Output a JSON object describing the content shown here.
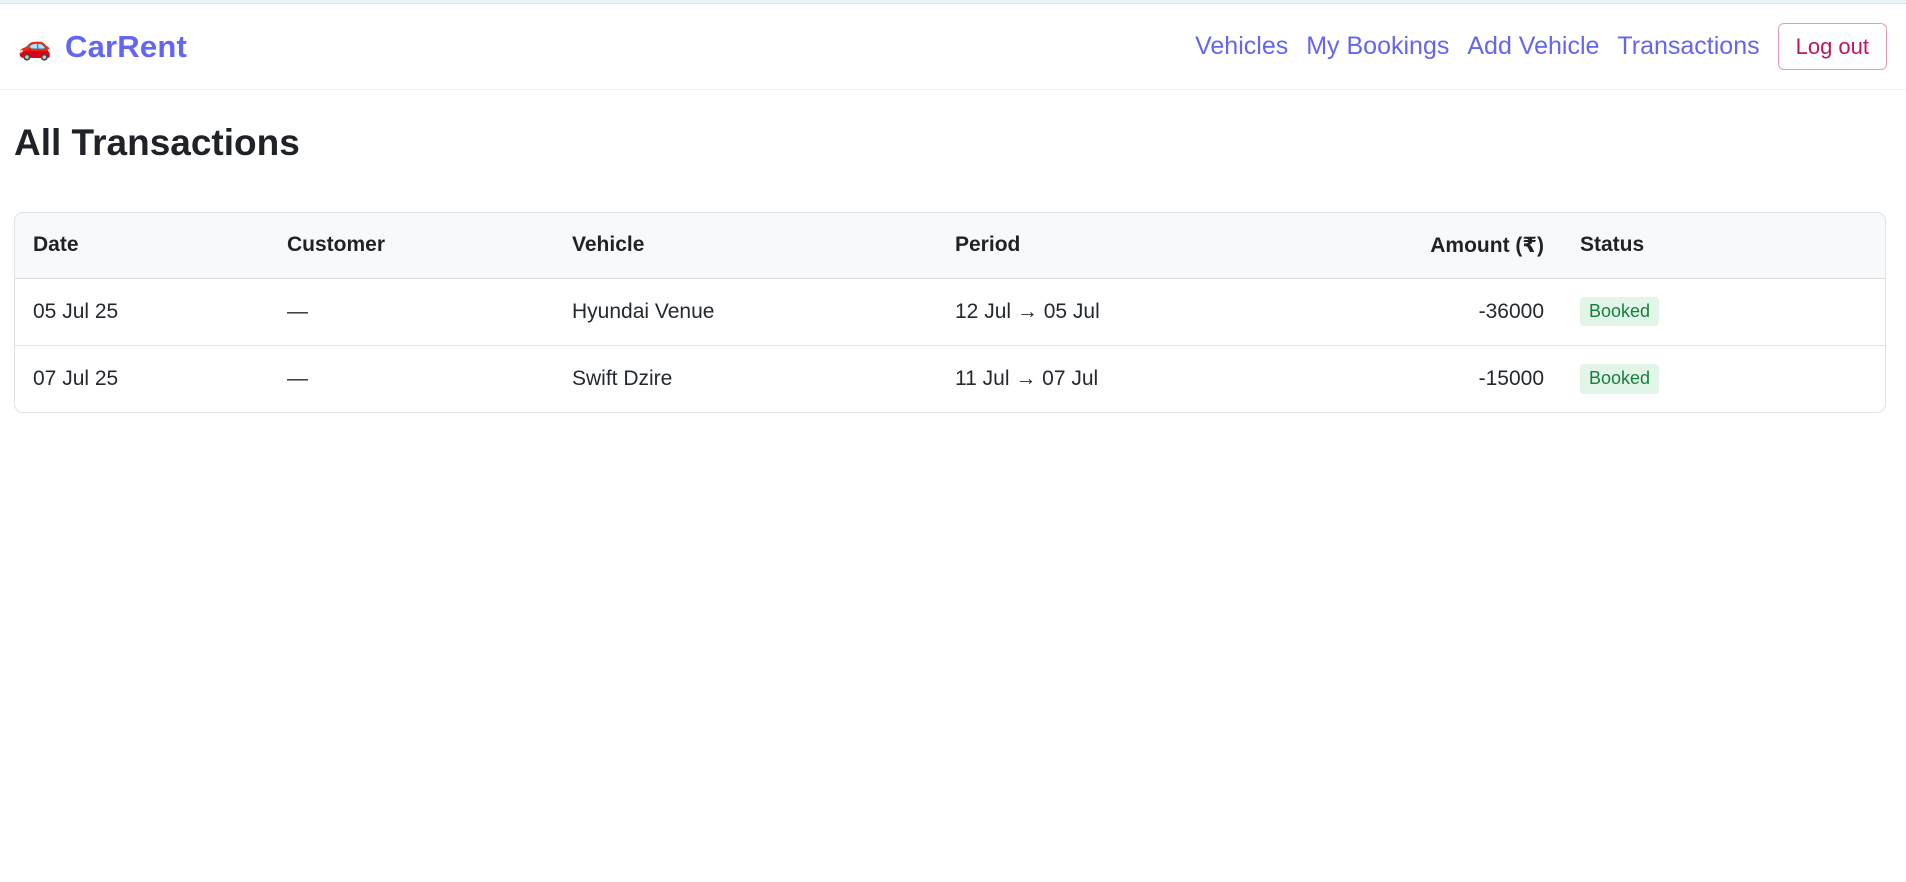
{
  "brand": {
    "icon": "car-icon",
    "icon_glyph": "🚗",
    "name": "CarRent"
  },
  "nav": {
    "items": [
      {
        "label": "Vehicles"
      },
      {
        "label": "My Bookings"
      },
      {
        "label": "Add Vehicle"
      },
      {
        "label": "Transactions"
      }
    ],
    "logout_label": "Log out"
  },
  "page": {
    "title": "All Transactions"
  },
  "table": {
    "headers": {
      "date": "Date",
      "customer": "Customer",
      "vehicle": "Vehicle",
      "period": "Period",
      "amount": "Amount (₹)",
      "status": "Status"
    },
    "rows": [
      {
        "date": "05 Jul 25",
        "customer": "—",
        "vehicle": "Hyundai Venue",
        "period": "12 Jul → 05 Jul",
        "amount": "-36000",
        "status": "Booked"
      },
      {
        "date": "07 Jul 25",
        "customer": "—",
        "vehicle": "Swift Dzire",
        "period": "11 Jul → 07 Jul",
        "amount": "-15000",
        "status": "Booked"
      }
    ]
  },
  "colors": {
    "accent": "#6366f1",
    "logout": "#be185d",
    "status_booked_text": "#15803d",
    "status_booked_bg": "#e3f5e9"
  }
}
